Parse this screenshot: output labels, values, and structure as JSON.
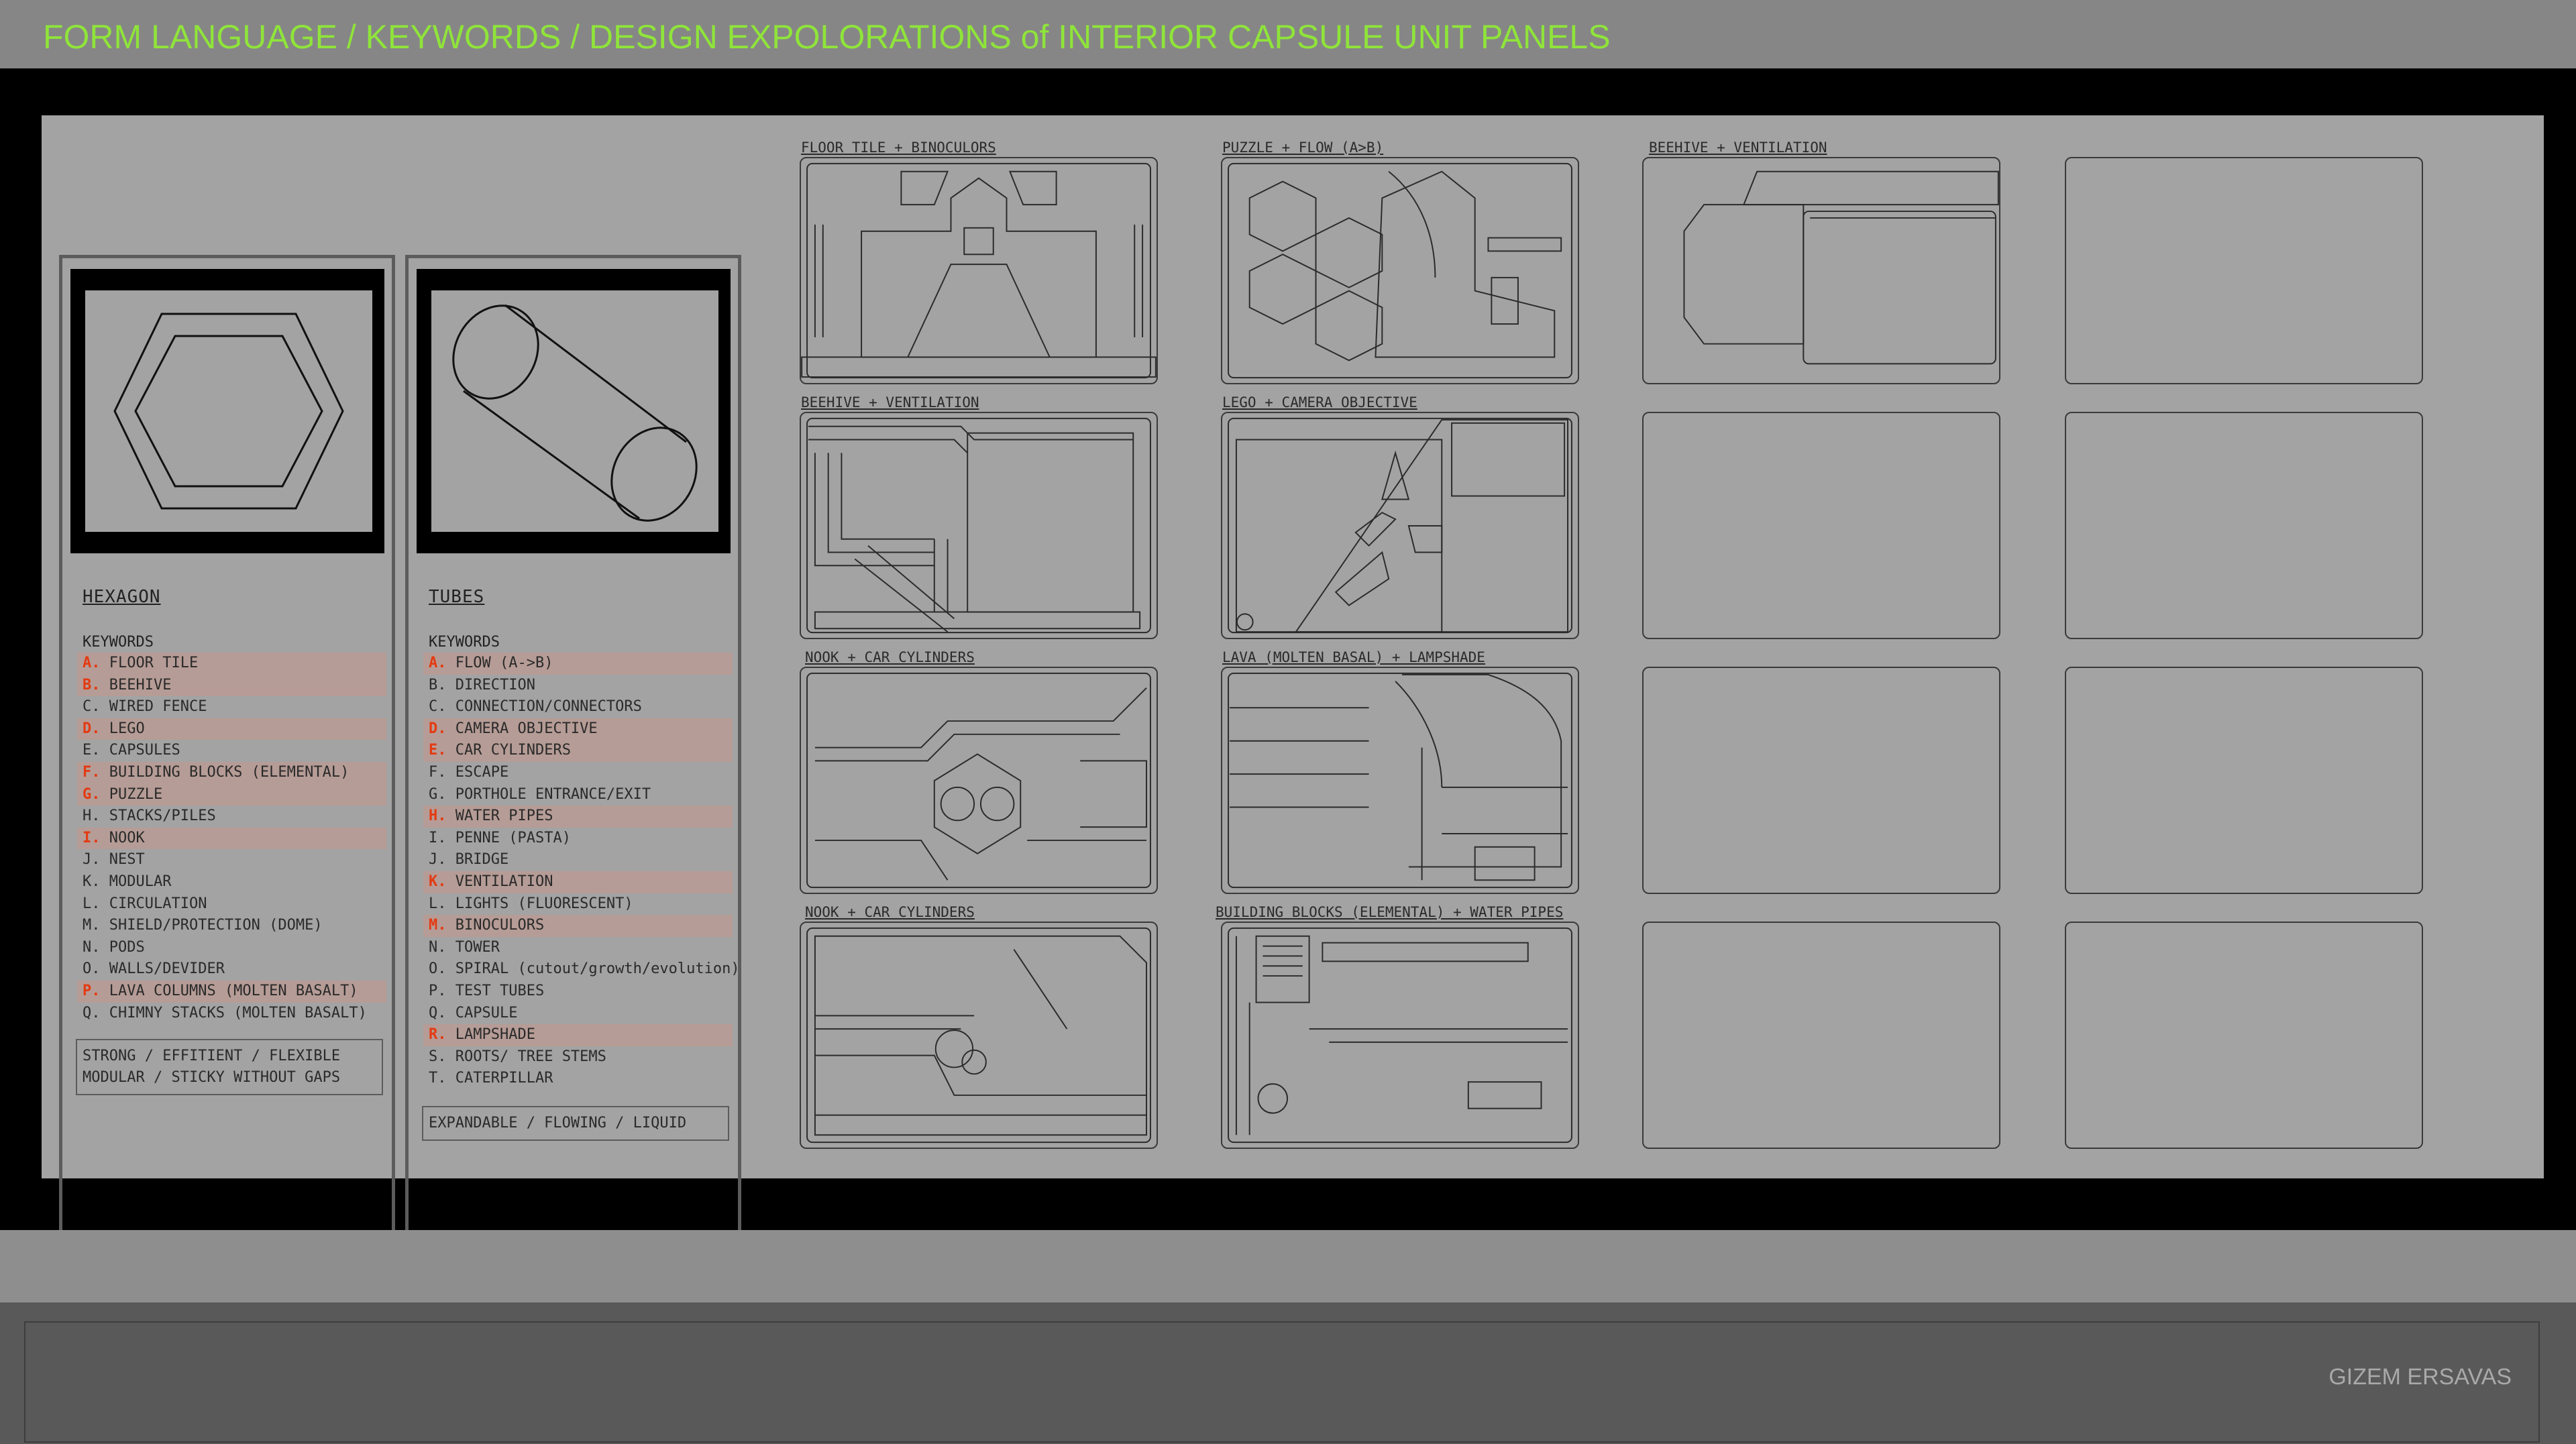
{
  "header": {
    "title": "FORM LANGUAGE / KEYWORDS / DESIGN EXPOLORATIONS of INTERIOR CAPSULE UNIT PANELS"
  },
  "columns": [
    {
      "title": "HEXAGON",
      "icon": "hexagon-icon",
      "keywords_label": "KEYWORDS",
      "keywords": [
        {
          "letter": "A.",
          "text": "FLOOR TILE",
          "highlight": true
        },
        {
          "letter": "B.",
          "text": "BEEHIVE",
          "highlight": true
        },
        {
          "letter": "C.",
          "text": "WIRED FENCE",
          "highlight": false
        },
        {
          "letter": "D.",
          "text": "LEGO",
          "highlight": true
        },
        {
          "letter": "E.",
          "text": "CAPSULES",
          "highlight": false
        },
        {
          "letter": "F.",
          "text": "BUILDING BLOCKS (ELEMENTAL)",
          "highlight": true
        },
        {
          "letter": "G.",
          "text": "PUZZLE",
          "highlight": true
        },
        {
          "letter": "H.",
          "text": "STACKS/PILES",
          "highlight": false
        },
        {
          "letter": "I.",
          "text": "NOOK",
          "highlight": true
        },
        {
          "letter": "J.",
          "text": "NEST",
          "highlight": false
        },
        {
          "letter": "K.",
          "text": "MODULAR",
          "highlight": false
        },
        {
          "letter": "L.",
          "text": "CIRCULATION",
          "highlight": false
        },
        {
          "letter": "M.",
          "text": "SHIELD/PROTECTION (DOME)",
          "highlight": false
        },
        {
          "letter": "N.",
          "text": "PODS",
          "highlight": false
        },
        {
          "letter": "O.",
          "text": "WALLS/DEVIDER",
          "highlight": false
        },
        {
          "letter": "P.",
          "text": "LAVA COLUMNS (MOLTEN BASALT)",
          "highlight": true
        },
        {
          "letter": "Q.",
          "text": "CHIMNY STACKS (MOLTEN BASALT)",
          "highlight": false
        }
      ],
      "summary_lines": [
        "STRONG / EFFITIENT / FLEXIBLE",
        "MODULAR / STICKY WITHOUT GAPS"
      ]
    },
    {
      "title": "TUBES",
      "icon": "cylinder-icon",
      "keywords_label": "KEYWORDS",
      "keywords": [
        {
          "letter": "A.",
          "text": "FLOW (A->B)",
          "highlight": true
        },
        {
          "letter": "B.",
          "text": "DIRECTION",
          "highlight": false
        },
        {
          "letter": "C.",
          "text": "CONNECTION/CONNECTORS",
          "highlight": false
        },
        {
          "letter": "D.",
          "text": "CAMERA OBJECTIVE",
          "highlight": true
        },
        {
          "letter": "E.",
          "text": "CAR CYLINDERS",
          "highlight": true
        },
        {
          "letter": "F.",
          "text": "ESCAPE",
          "highlight": false
        },
        {
          "letter": "G.",
          "text": "PORTHOLE ENTRANCE/EXIT",
          "highlight": false
        },
        {
          "letter": "H.",
          "text": "WATER PIPES",
          "highlight": true
        },
        {
          "letter": "I.",
          "text": "PENNE (PASTA)",
          "highlight": false
        },
        {
          "letter": "J.",
          "text": "BRIDGE",
          "highlight": false
        },
        {
          "letter": "K.",
          "text": "VENTILATION",
          "highlight": true
        },
        {
          "letter": "L.",
          "text": "LIGHTS (FLUORESCENT)",
          "highlight": false
        },
        {
          "letter": "M.",
          "text": "BINOCULORS",
          "highlight": true
        },
        {
          "letter": "N.",
          "text": "TOWER",
          "highlight": false
        },
        {
          "letter": "O.",
          "text": "SPIRAL (cutout/growth/evolution)",
          "highlight": false
        },
        {
          "letter": "P.",
          "text": "TEST TUBES",
          "highlight": false
        },
        {
          "letter": "Q.",
          "text": "CAPSULE",
          "highlight": false
        },
        {
          "letter": "R.",
          "text": "LAMPSHADE",
          "highlight": true
        },
        {
          "letter": "S.",
          "text": "ROOTS/ TREE STEMS",
          "highlight": false
        },
        {
          "letter": "T.",
          "text": "CATERPILLAR",
          "highlight": false
        }
      ],
      "summary_lines": [
        "EXPANDABLE / FLOWING / LIQUID"
      ]
    }
  ],
  "panels": [
    {
      "label": "FLOOR TILE + BINOCULORS"
    },
    {
      "label": "PUZZLE + FLOW (A>B)"
    },
    {
      "label": "BEEHIVE + VENTILATION"
    },
    {
      "label": ""
    },
    {
      "label": "BEEHIVE + VENTILATION"
    },
    {
      "label": "LEGO + CAMERA OBJECTIVE"
    },
    {
      "label": ""
    },
    {
      "label": ""
    },
    {
      "label": "NOOK + CAR CYLINDERS"
    },
    {
      "label": "LAVA (MOLTEN BASAL) + LAMPSHADE"
    },
    {
      "label": ""
    },
    {
      "label": ""
    },
    {
      "label": "NOOK + CAR CYLINDERS"
    },
    {
      "label": "BUILDING BLOCKS (ELEMENTAL) + WATER PIPES"
    },
    {
      "label": ""
    },
    {
      "label": ""
    }
  ],
  "footer": {
    "author": "GIZEM ERSAVAS"
  },
  "colors": {
    "title": "#8fe43a",
    "highlight": "#b69c96",
    "letter": "#e33a12"
  }
}
